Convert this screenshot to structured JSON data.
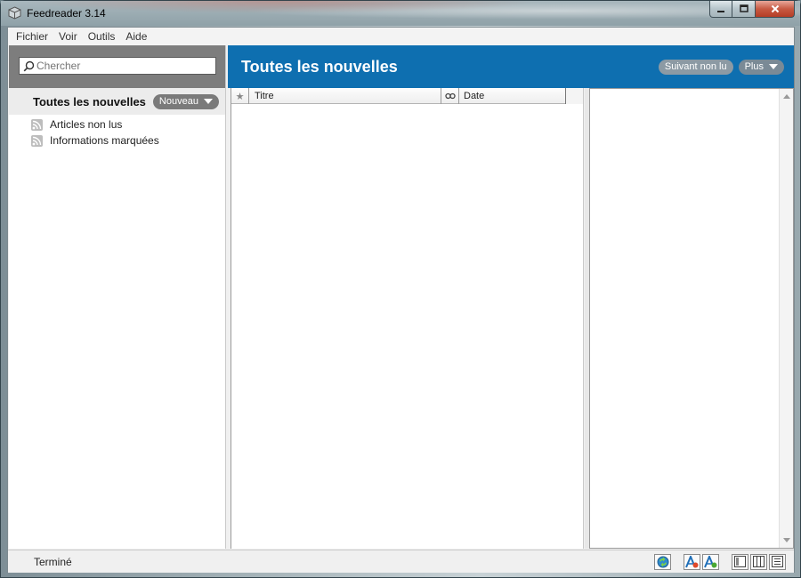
{
  "window": {
    "title": "Feedreader 3.14",
    "buttons": {
      "minimize": "—",
      "maximize": "☐",
      "close": "✕"
    }
  },
  "menu": {
    "items": [
      "Fichier",
      "Voir",
      "Outils",
      "Aide"
    ]
  },
  "sidebar": {
    "search": {
      "placeholder": "Chercher",
      "value": ""
    },
    "header": {
      "title": "Toutes les nouvelles",
      "new_button": "Nouveau"
    },
    "feeds": [
      {
        "label": "Articles non lus",
        "icon": "feed-icon"
      },
      {
        "label": "Informations marquées",
        "icon": "feed-icon"
      }
    ]
  },
  "main": {
    "title": "Toutes les nouvelles",
    "next_unread_button": "Suivant non lu",
    "more_button": "Plus"
  },
  "article_list": {
    "columns": {
      "star": "★",
      "title": "Titre",
      "attachment": "attachment-icon",
      "date": "Date"
    },
    "rows": []
  },
  "status": {
    "text": "Terminé",
    "icons": [
      "refresh-icon",
      "font-decrease-icon",
      "font-increase-icon",
      "layout-one-pane-icon",
      "layout-three-pane-icon",
      "layout-list-icon"
    ]
  },
  "colors": {
    "header_blue": "#0e6fb0",
    "search_area": "#7d7d7d",
    "pill": "#7a7a7a"
  }
}
